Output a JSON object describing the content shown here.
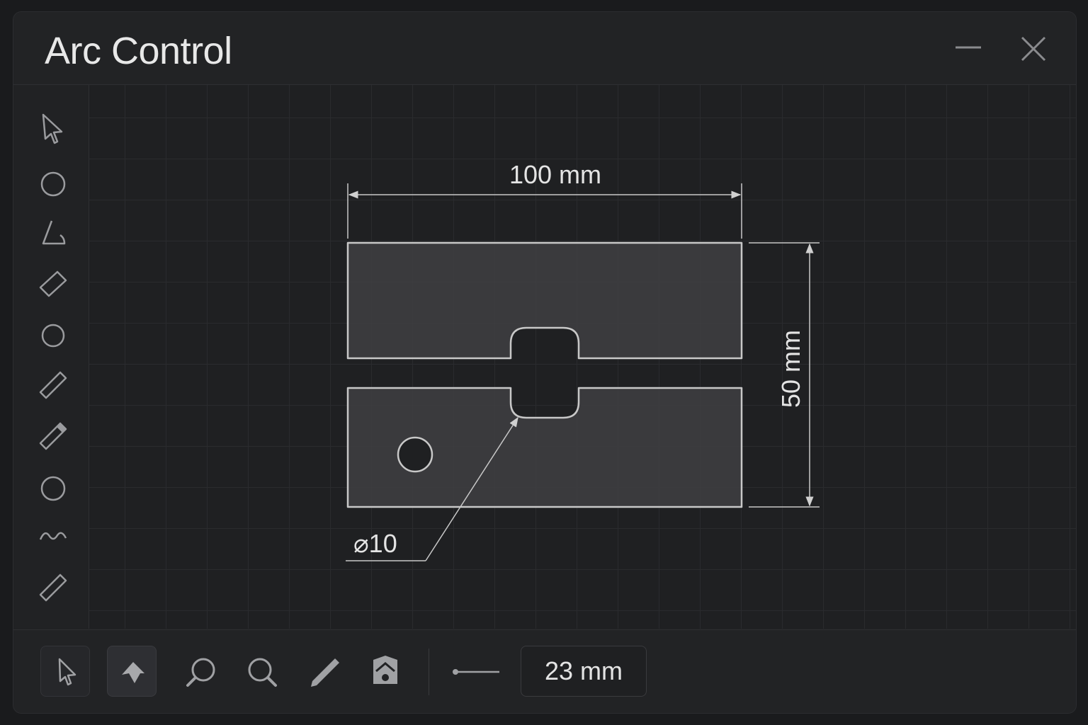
{
  "window": {
    "title": "Arc Control"
  },
  "titlebar": {
    "minimize_icon": "minimize-icon",
    "close_icon": "close-icon"
  },
  "sidebar": {
    "tools": [
      {
        "icon": "pointer-icon"
      },
      {
        "icon": "circle-icon"
      },
      {
        "icon": "angle-icon"
      },
      {
        "icon": "diamond-icon"
      },
      {
        "icon": "circle-icon"
      },
      {
        "icon": "line-icon"
      },
      {
        "icon": "ruler-icon"
      },
      {
        "icon": "circle-icon"
      },
      {
        "icon": "wave-icon"
      },
      {
        "icon": "line-icon"
      }
    ]
  },
  "drawing": {
    "width_dimension": "100 mm",
    "height_dimension": "50 mm",
    "hole_callout": "⌀10"
  },
  "bottombar": {
    "measure_value": "23 mm",
    "tools": [
      "select-icon",
      "arc-arrow-icon",
      "search-icon",
      "zoom-icon",
      "pencil-icon",
      "home-icon",
      "line-weight-icon"
    ]
  },
  "colors": {
    "background": "#1a1b1d",
    "panel": "#212224",
    "stroke": "#c8c8c8",
    "part_fill": "#3f4042"
  }
}
